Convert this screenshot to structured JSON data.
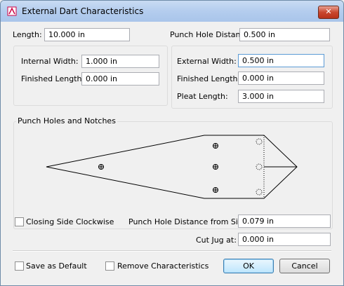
{
  "window": {
    "title": "External Dart Characteristics",
    "close_label": "✕"
  },
  "top": {
    "length_label": "Length:",
    "length_value": "10.000 in",
    "punch_hole_distance_label": "Punch Hole Distance:",
    "punch_hole_distance_value": "0.500 in"
  },
  "internal": {
    "width_label": "Internal Width:",
    "width_value": "1.000 in",
    "finished_length_label": "Finished Length:",
    "finished_length_value": "0.000 in"
  },
  "external": {
    "width_label": "External Width:",
    "width_value": "0.500 in",
    "finished_length_label": "Finished Length:",
    "finished_length_value": "0.000 in",
    "pleat_length_label": "Pleat Length:",
    "pleat_length_value": "3.000 in"
  },
  "punch_group": {
    "title": "Punch Holes and Notches"
  },
  "options": {
    "closing_clockwise_label": "Closing Side Clockwise",
    "distance_from_side_label": "Punch Hole Distance from Side:",
    "distance_from_side_value": "0.079 in",
    "cut_jug_label": "Cut Jug at:",
    "cut_jug_value": "0.000 in"
  },
  "footer": {
    "save_default_label": "Save as Default",
    "remove_label": "Remove Characteristics",
    "ok_label": "OK",
    "cancel_label": "Cancel"
  }
}
